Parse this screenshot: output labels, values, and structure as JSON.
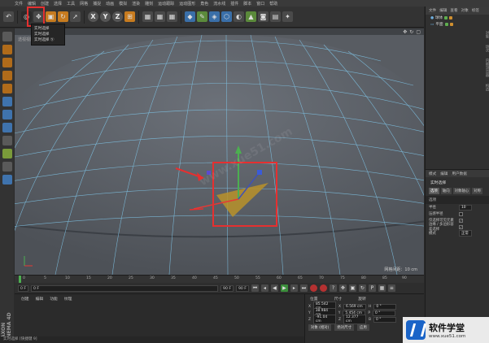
{
  "menubar": {
    "items": [
      "文件",
      "编辑",
      "创建",
      "选择",
      "工具",
      "网格",
      "捕捉",
      "动画",
      "模拟",
      "渲染",
      "雕刻",
      "运动跟踪",
      "运动图形",
      "角色",
      "流水线",
      "插件",
      "脚本",
      "窗口",
      "帮助"
    ]
  },
  "toolbar": {
    "x_label": "X",
    "y_label": "Y",
    "z_label": "Z"
  },
  "selection_menu": {
    "items": [
      "实时选择",
      "实时选择",
      "实时选择 Ⓢ"
    ]
  },
  "viewport": {
    "title": "透视视图",
    "grid_spacing": "网格间距：10 cm"
  },
  "object_manager": {
    "tabs": [
      "文件",
      "编辑",
      "查看",
      "对象",
      "标签",
      "书签"
    ],
    "objects": [
      {
        "name": "球体"
      },
      {
        "name": "平面"
      }
    ],
    "side_tabs": [
      "对象",
      "场次",
      "内容浏览器",
      "构造"
    ]
  },
  "attributes": {
    "tabs": [
      "模式",
      "编辑",
      "用户数据"
    ],
    "title": "实时选择",
    "subtabs": [
      "选项",
      "轴向",
      "对象轴心",
      "对称"
    ],
    "section": "选项",
    "rows": [
      {
        "label": "半径",
        "value": "10"
      },
      {
        "label": "压感半径",
        "check": true
      },
      {
        "label": "仅选择可见元素",
        "check": true
      },
      {
        "label": "边缘 / 多边形容差选择",
        "check": true
      }
    ],
    "mode_label": "模式",
    "mode_value": "正常"
  },
  "timeline": {
    "ticks": [
      "0",
      "5",
      "10",
      "15",
      "20",
      "25",
      "30",
      "35",
      "40",
      "45",
      "50",
      "55",
      "60",
      "65",
      "70",
      "75",
      "80",
      "85",
      "90"
    ],
    "end_frame": "0 F"
  },
  "transport": {
    "start": "0 F",
    "current": "0 F",
    "end": "90 F",
    "end2": "90 F"
  },
  "material_manager": {
    "tabs": [
      "创建",
      "编辑",
      "功能",
      "纹理"
    ]
  },
  "coordinates": {
    "headers": [
      "位置",
      "尺寸",
      "旋转"
    ],
    "rows": [
      {
        "axis": "X",
        "pos": "85.542 cm",
        "size": "6.569 cm",
        "rot_label": "H",
        "rot": "0 °"
      },
      {
        "axis": "Y",
        "pos": "38.984 cm",
        "size": "5.454 cm",
        "rot_label": "P",
        "rot": "0 °"
      },
      {
        "axis": "Z",
        "pos": "-91.04 cm",
        "size": "12.377 cm",
        "rot_label": "B",
        "rot": "0 °"
      }
    ],
    "mode": "对象 (相对)",
    "size_mode": "绝对尺寸",
    "apply": "应用"
  },
  "status": {
    "text": "实时选择 [快捷键 9]"
  },
  "brand": {
    "maxon": "MAXON CINEMA 4D",
    "logo_text": "软件学堂",
    "logo_url": "www.xue51.com",
    "accent": "#e53030"
  }
}
